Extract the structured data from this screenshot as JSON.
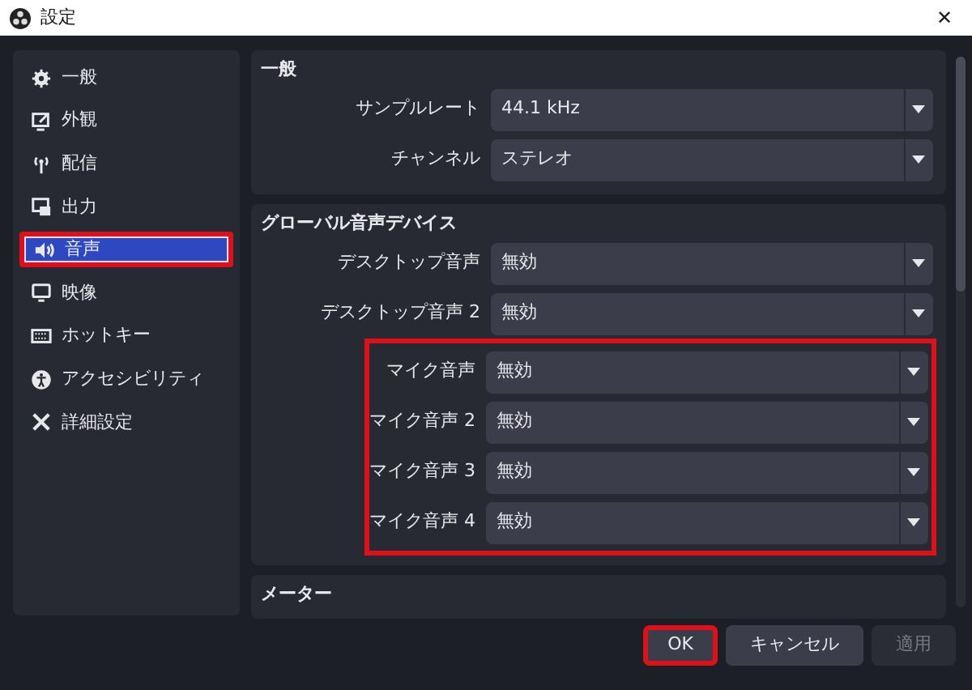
{
  "window": {
    "title": "設定",
    "close": "✕"
  },
  "sidebar": {
    "items": [
      {
        "kind": "gear",
        "label": "一般",
        "selected": false,
        "highlighted": false
      },
      {
        "kind": "appearance",
        "label": "外観",
        "selected": false,
        "highlighted": false
      },
      {
        "kind": "antenna",
        "label": "配信",
        "selected": false,
        "highlighted": false
      },
      {
        "kind": "output",
        "label": "出力",
        "selected": false,
        "highlighted": false
      },
      {
        "kind": "speaker",
        "label": "音声",
        "selected": true,
        "highlighted": true
      },
      {
        "kind": "monitor",
        "label": "映像",
        "selected": false,
        "highlighted": false
      },
      {
        "kind": "keyboard",
        "label": "ホットキー",
        "selected": false,
        "highlighted": false
      },
      {
        "kind": "accessibility",
        "label": "アクセシビリティ",
        "selected": false,
        "highlighted": false
      },
      {
        "kind": "tools",
        "label": "詳細設定",
        "selected": false,
        "highlighted": false
      }
    ]
  },
  "sections": [
    {
      "title": "一般",
      "groups": [
        {
          "highlighted": false,
          "rows": [
            {
              "label": "サンプルレート",
              "value": "44.1 kHz"
            },
            {
              "label": "チャンネル",
              "value": "ステレオ"
            }
          ]
        }
      ]
    },
    {
      "title": "グローバル音声デバイス",
      "groups": [
        {
          "highlighted": false,
          "rows": [
            {
              "label": "デスクトップ音声",
              "value": "無効"
            },
            {
              "label": "デスクトップ音声 2",
              "value": "無効"
            }
          ]
        },
        {
          "highlighted": true,
          "rows": [
            {
              "label": "マイク音声",
              "value": "無効"
            },
            {
              "label": "マイク音声 2",
              "value": "無効"
            },
            {
              "label": "マイク音声 3",
              "value": "無効"
            },
            {
              "label": "マイク音声 4",
              "value": "無効"
            }
          ]
        }
      ]
    },
    {
      "title": "メーター"
    }
  ],
  "buttons": [
    {
      "label": "OK",
      "highlighted": true,
      "disabled": false
    },
    {
      "label": "キャンセル",
      "highlighted": false,
      "disabled": false
    },
    {
      "label": "適用",
      "highlighted": false,
      "disabled": true
    }
  ]
}
